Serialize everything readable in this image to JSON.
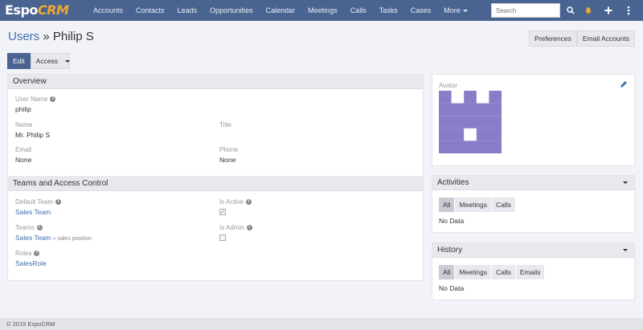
{
  "logo": {
    "part1": "Espo",
    "part2": "CRM"
  },
  "nav": {
    "items": [
      "Accounts",
      "Contacts",
      "Leads",
      "Opportunities",
      "Calendar",
      "Meetings",
      "Calls",
      "Tasks",
      "Cases"
    ],
    "more": "More",
    "search_placeholder": "Search"
  },
  "header": {
    "breadcrumb": "Users",
    "separator": " » ",
    "name": "Philip S"
  },
  "header_buttons": {
    "preferences": "Preferences",
    "email_accounts": "Email Accounts"
  },
  "actions": {
    "edit": "Edit",
    "access": "Access"
  },
  "overview": {
    "title": "Overview",
    "user_name_label": "User Name",
    "user_name": "philip",
    "name_label": "Name",
    "name": "Mr. Philip S",
    "title_label": "Title",
    "email_label": "Email",
    "email": "None",
    "phone_label": "Phone",
    "phone": "None"
  },
  "teams": {
    "title": "Teams and Access Control",
    "default_team_label": "Default Team",
    "default_team": "Sales Team",
    "is_active_label": "Is Active",
    "teams_label": "Teams",
    "team": "Sales Team",
    "team_position": "» sales position",
    "is_admin_label": "Is Admin",
    "roles_label": "Roles",
    "role": "SalesRole",
    "is_active": true,
    "is_admin": false
  },
  "avatar": {
    "label": "Avatar",
    "color": "#8b7cc8"
  },
  "activities": {
    "title": "Activities",
    "tabs": [
      "All",
      "Meetings",
      "Calls"
    ],
    "empty": "No Data"
  },
  "history": {
    "title": "History",
    "tabs": [
      "All",
      "Meetings",
      "Calls",
      "Emails"
    ],
    "empty": "No Data"
  },
  "footer": {
    "text": "© 2015 EspoCRM"
  },
  "colors": {
    "navbar": "#4a6492",
    "link": "#3f6ea8",
    "bell": "#f0a830"
  }
}
